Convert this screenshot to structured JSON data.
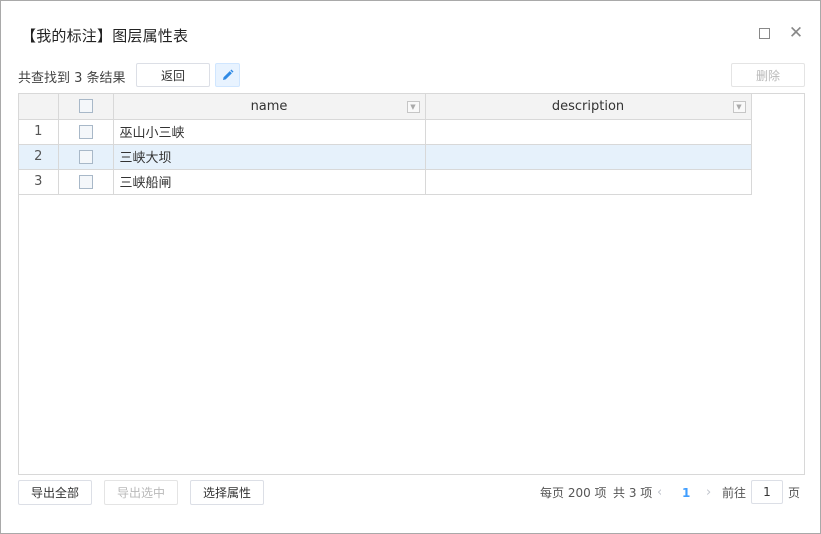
{
  "dialog": {
    "title": "【我的标注】图层属性表",
    "maximize_icon": "maximize-icon",
    "close_icon": "close-icon",
    "close_glyph": "✕"
  },
  "toolbar": {
    "result_text": "共查找到 3 条结果",
    "back_label": "返回",
    "edit_icon": "pencil-icon",
    "delete_label": "删除"
  },
  "table": {
    "columns": [
      "name",
      "description"
    ],
    "rows": [
      {
        "index": "1",
        "name": "巫山小三峡",
        "description": "",
        "selected": false
      },
      {
        "index": "2",
        "name": "三峡大坝",
        "description": "",
        "selected": true
      },
      {
        "index": "3",
        "name": "三峡船闸",
        "description": "",
        "selected": false
      }
    ]
  },
  "footer": {
    "export_all_label": "导出全部",
    "export_selected_label": "导出选中",
    "select_attr_label": "选择属性"
  },
  "pagination": {
    "page_size_text": "每页 200 项",
    "total_text": "共 3 项",
    "prev_glyph": "‹",
    "current_page": "1",
    "next_glyph": "›",
    "goto_label": "前往",
    "goto_value": "1",
    "page_unit": "页"
  },
  "colors": {
    "accent": "#409eff",
    "selected_row": "#e6f1fb",
    "header_bg": "#f3f3f3"
  }
}
